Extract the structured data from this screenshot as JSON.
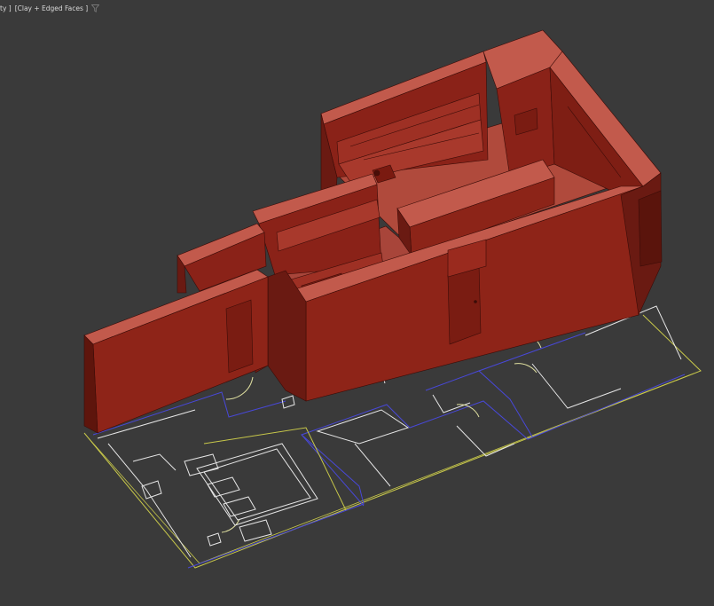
{
  "viewport": {
    "label_view": "ty ]",
    "label_shading": "[Clay + Edged Faces ]",
    "filter_icon": "funnel-icon"
  },
  "colors": {
    "background": "#3a3a3a",
    "clay_top": "#c25a4c",
    "clay_face": "#9a2a1e",
    "clay_dark": "#6a1a12",
    "plan_white": "#e6e6e6",
    "plan_yellow": "#c8c84a",
    "plan_blue": "#3a3ad0"
  }
}
